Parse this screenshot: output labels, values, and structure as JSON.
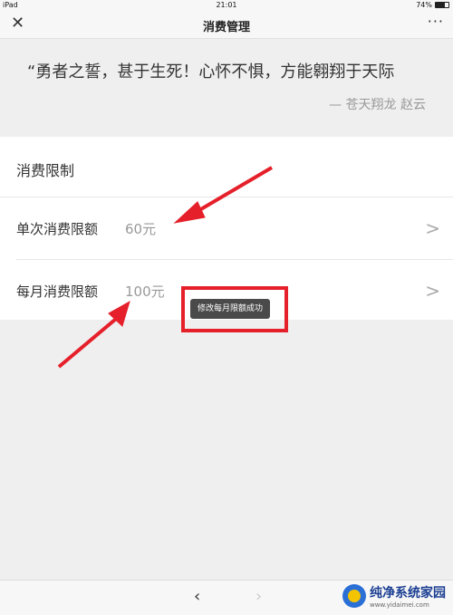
{
  "status": {
    "device": "iPad",
    "time": "21:01",
    "battery": "74%",
    "battery_level": 0.74
  },
  "nav": {
    "close_glyph": "✕",
    "title": "消费管理",
    "more_glyph": "···"
  },
  "quote": {
    "text": "“勇者之誓，甚于生死！心怀不惧，方能翱翔于天际",
    "author": "— 苍天翔龙 赵云"
  },
  "section": {
    "title": "消费限制"
  },
  "rows": [
    {
      "label": "单次消费限额",
      "value": "60元"
    },
    {
      "label": "每月消费限额",
      "value": "100元"
    }
  ],
  "toast": {
    "text": "修改每月限额成功"
  },
  "bottom": {
    "back_glyph": "‹",
    "forward_glyph": "›"
  },
  "watermark": {
    "text": "纯净系统家园",
    "url": "www.yidaimei.com"
  },
  "colors": {
    "annotation_red": "#e5202a",
    "toast_bg": "#4a4a4a"
  }
}
